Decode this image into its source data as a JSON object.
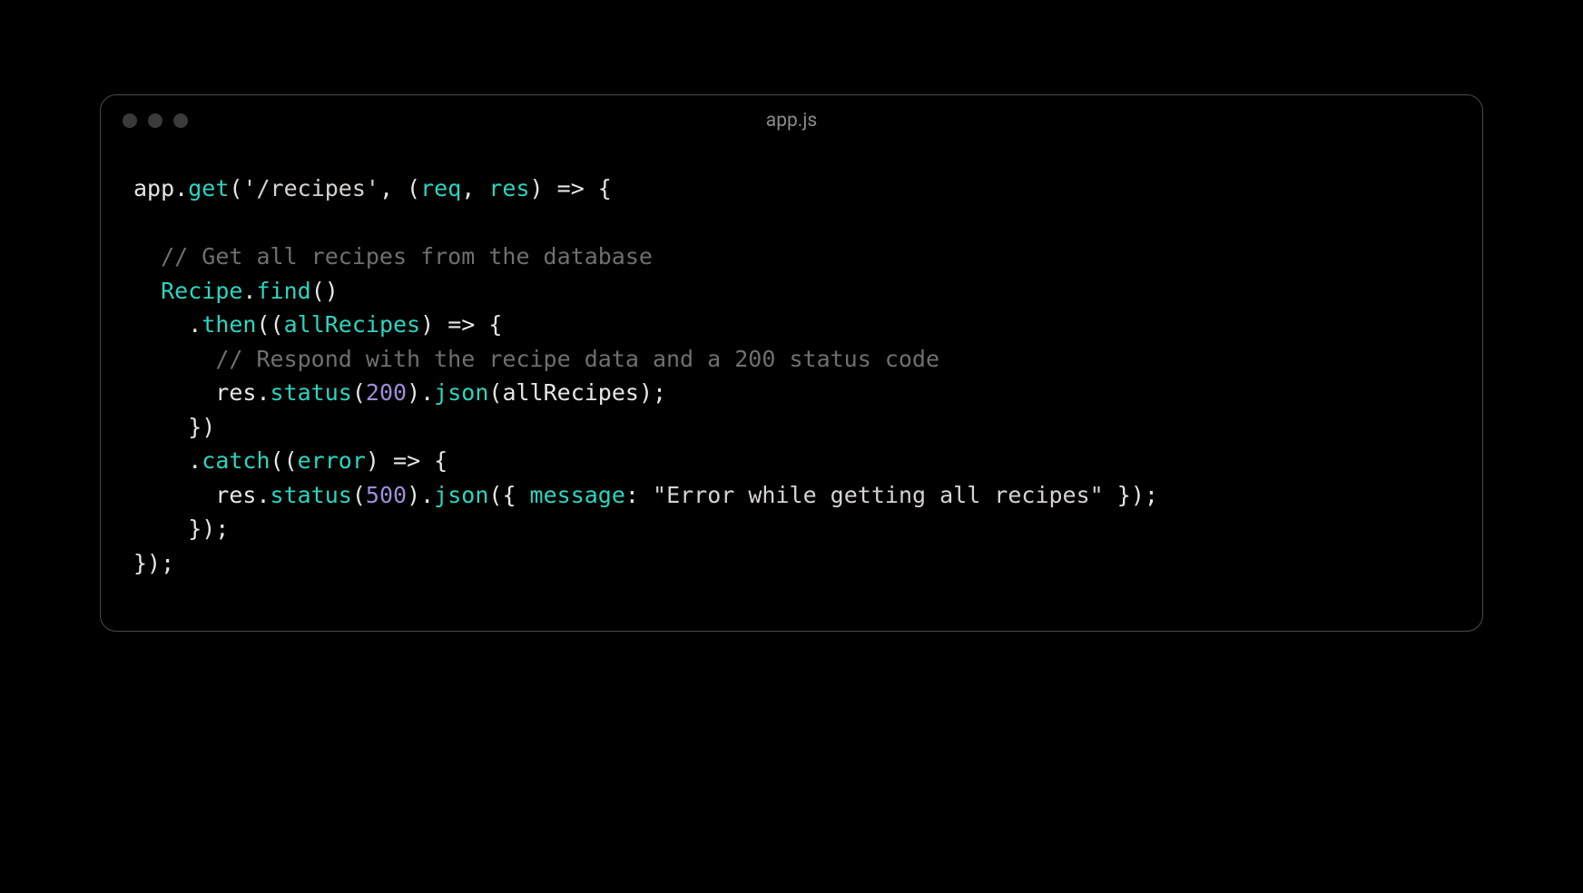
{
  "window": {
    "filename": "app.js"
  },
  "code": {
    "tokens": [
      [
        {
          "t": "app",
          "c": "tk-default"
        },
        {
          "t": ".",
          "c": "tk-punct"
        },
        {
          "t": "get",
          "c": "tk-method"
        },
        {
          "t": "(",
          "c": "tk-punct"
        },
        {
          "t": "'/recipes'",
          "c": "tk-string"
        },
        {
          "t": ", (",
          "c": "tk-punct"
        },
        {
          "t": "req",
          "c": "tk-param"
        },
        {
          "t": ", ",
          "c": "tk-punct"
        },
        {
          "t": "res",
          "c": "tk-param"
        },
        {
          "t": ") ",
          "c": "tk-punct"
        },
        {
          "t": "=>",
          "c": "tk-default"
        },
        {
          "t": " {",
          "c": "tk-punct"
        }
      ],
      [],
      [
        {
          "t": "  ",
          "c": "tk-default"
        },
        {
          "t": "// Get all recipes from the database",
          "c": "tk-comment"
        }
      ],
      [
        {
          "t": "  ",
          "c": "tk-default"
        },
        {
          "t": "Recipe",
          "c": "tk-class"
        },
        {
          "t": ".",
          "c": "tk-punct"
        },
        {
          "t": "find",
          "c": "tk-method"
        },
        {
          "t": "()",
          "c": "tk-punct"
        }
      ],
      [
        {
          "t": "    .",
          "c": "tk-punct"
        },
        {
          "t": "then",
          "c": "tk-method"
        },
        {
          "t": "((",
          "c": "tk-punct"
        },
        {
          "t": "allRecipes",
          "c": "tk-param"
        },
        {
          "t": ") ",
          "c": "tk-punct"
        },
        {
          "t": "=>",
          "c": "tk-default"
        },
        {
          "t": " {",
          "c": "tk-punct"
        }
      ],
      [
        {
          "t": "      ",
          "c": "tk-default"
        },
        {
          "t": "// Respond with the recipe data and a 200 status code",
          "c": "tk-comment"
        }
      ],
      [
        {
          "t": "      res",
          "c": "tk-default"
        },
        {
          "t": ".",
          "c": "tk-punct"
        },
        {
          "t": "status",
          "c": "tk-method"
        },
        {
          "t": "(",
          "c": "tk-punct"
        },
        {
          "t": "200",
          "c": "tk-number"
        },
        {
          "t": ").",
          "c": "tk-punct"
        },
        {
          "t": "json",
          "c": "tk-method"
        },
        {
          "t": "(allRecipes);",
          "c": "tk-punct"
        }
      ],
      [
        {
          "t": "    })",
          "c": "tk-punct"
        }
      ],
      [
        {
          "t": "    .",
          "c": "tk-punct"
        },
        {
          "t": "catch",
          "c": "tk-method"
        },
        {
          "t": "((",
          "c": "tk-punct"
        },
        {
          "t": "error",
          "c": "tk-param"
        },
        {
          "t": ") ",
          "c": "tk-punct"
        },
        {
          "t": "=>",
          "c": "tk-default"
        },
        {
          "t": " {",
          "c": "tk-punct"
        }
      ],
      [
        {
          "t": "      res",
          "c": "tk-default"
        },
        {
          "t": ".",
          "c": "tk-punct"
        },
        {
          "t": "status",
          "c": "tk-method"
        },
        {
          "t": "(",
          "c": "tk-punct"
        },
        {
          "t": "500",
          "c": "tk-number"
        },
        {
          "t": ").",
          "c": "tk-punct"
        },
        {
          "t": "json",
          "c": "tk-method"
        },
        {
          "t": "({ ",
          "c": "tk-punct"
        },
        {
          "t": "message",
          "c": "tk-param"
        },
        {
          "t": ": ",
          "c": "tk-punct"
        },
        {
          "t": "\"Error while getting all recipes\"",
          "c": "tk-string"
        },
        {
          "t": " });",
          "c": "tk-punct"
        }
      ],
      [
        {
          "t": "    });",
          "c": "tk-punct"
        }
      ],
      [
        {
          "t": "});",
          "c": "tk-punct"
        }
      ]
    ]
  }
}
